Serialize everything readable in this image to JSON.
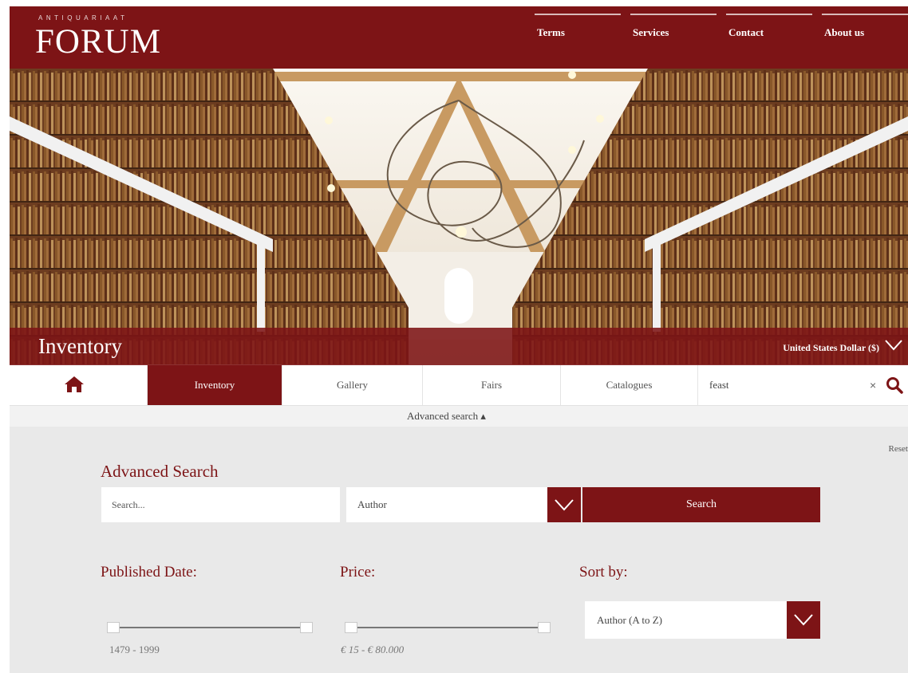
{
  "brand": {
    "small": "ANTIQUARIAAT",
    "name": "FORUM"
  },
  "top_nav": {
    "items": [
      "Terms",
      "Services",
      "Contact",
      "About us"
    ]
  },
  "hero": {
    "title": "Inventory",
    "currency": "United States Dollar ($)"
  },
  "tabs": {
    "items": [
      "Inventory",
      "Gallery",
      "Fairs",
      "Catalogues"
    ],
    "active": "Inventory"
  },
  "search": {
    "query": "feast",
    "clear": "×"
  },
  "advanced_toggle": "Advanced search ▴",
  "advanced": {
    "reset": "Reset",
    "title": "Advanced Search",
    "search_placeholder": "Search...",
    "field_select": "Author",
    "search_button": "Search",
    "published_date_label": "Published Date:",
    "price_label": "Price:",
    "sort_label": "Sort by:",
    "date_range": "1479 - 1999",
    "price_range": "€ 15 - € 80.000",
    "sort_value": "Author (A to Z)"
  },
  "colors": {
    "brand": "#7d1416",
    "panel_bg": "#e9e9e9"
  },
  "icons": [
    "home-icon",
    "search-icon",
    "chevron-down-icon",
    "close-icon"
  ]
}
